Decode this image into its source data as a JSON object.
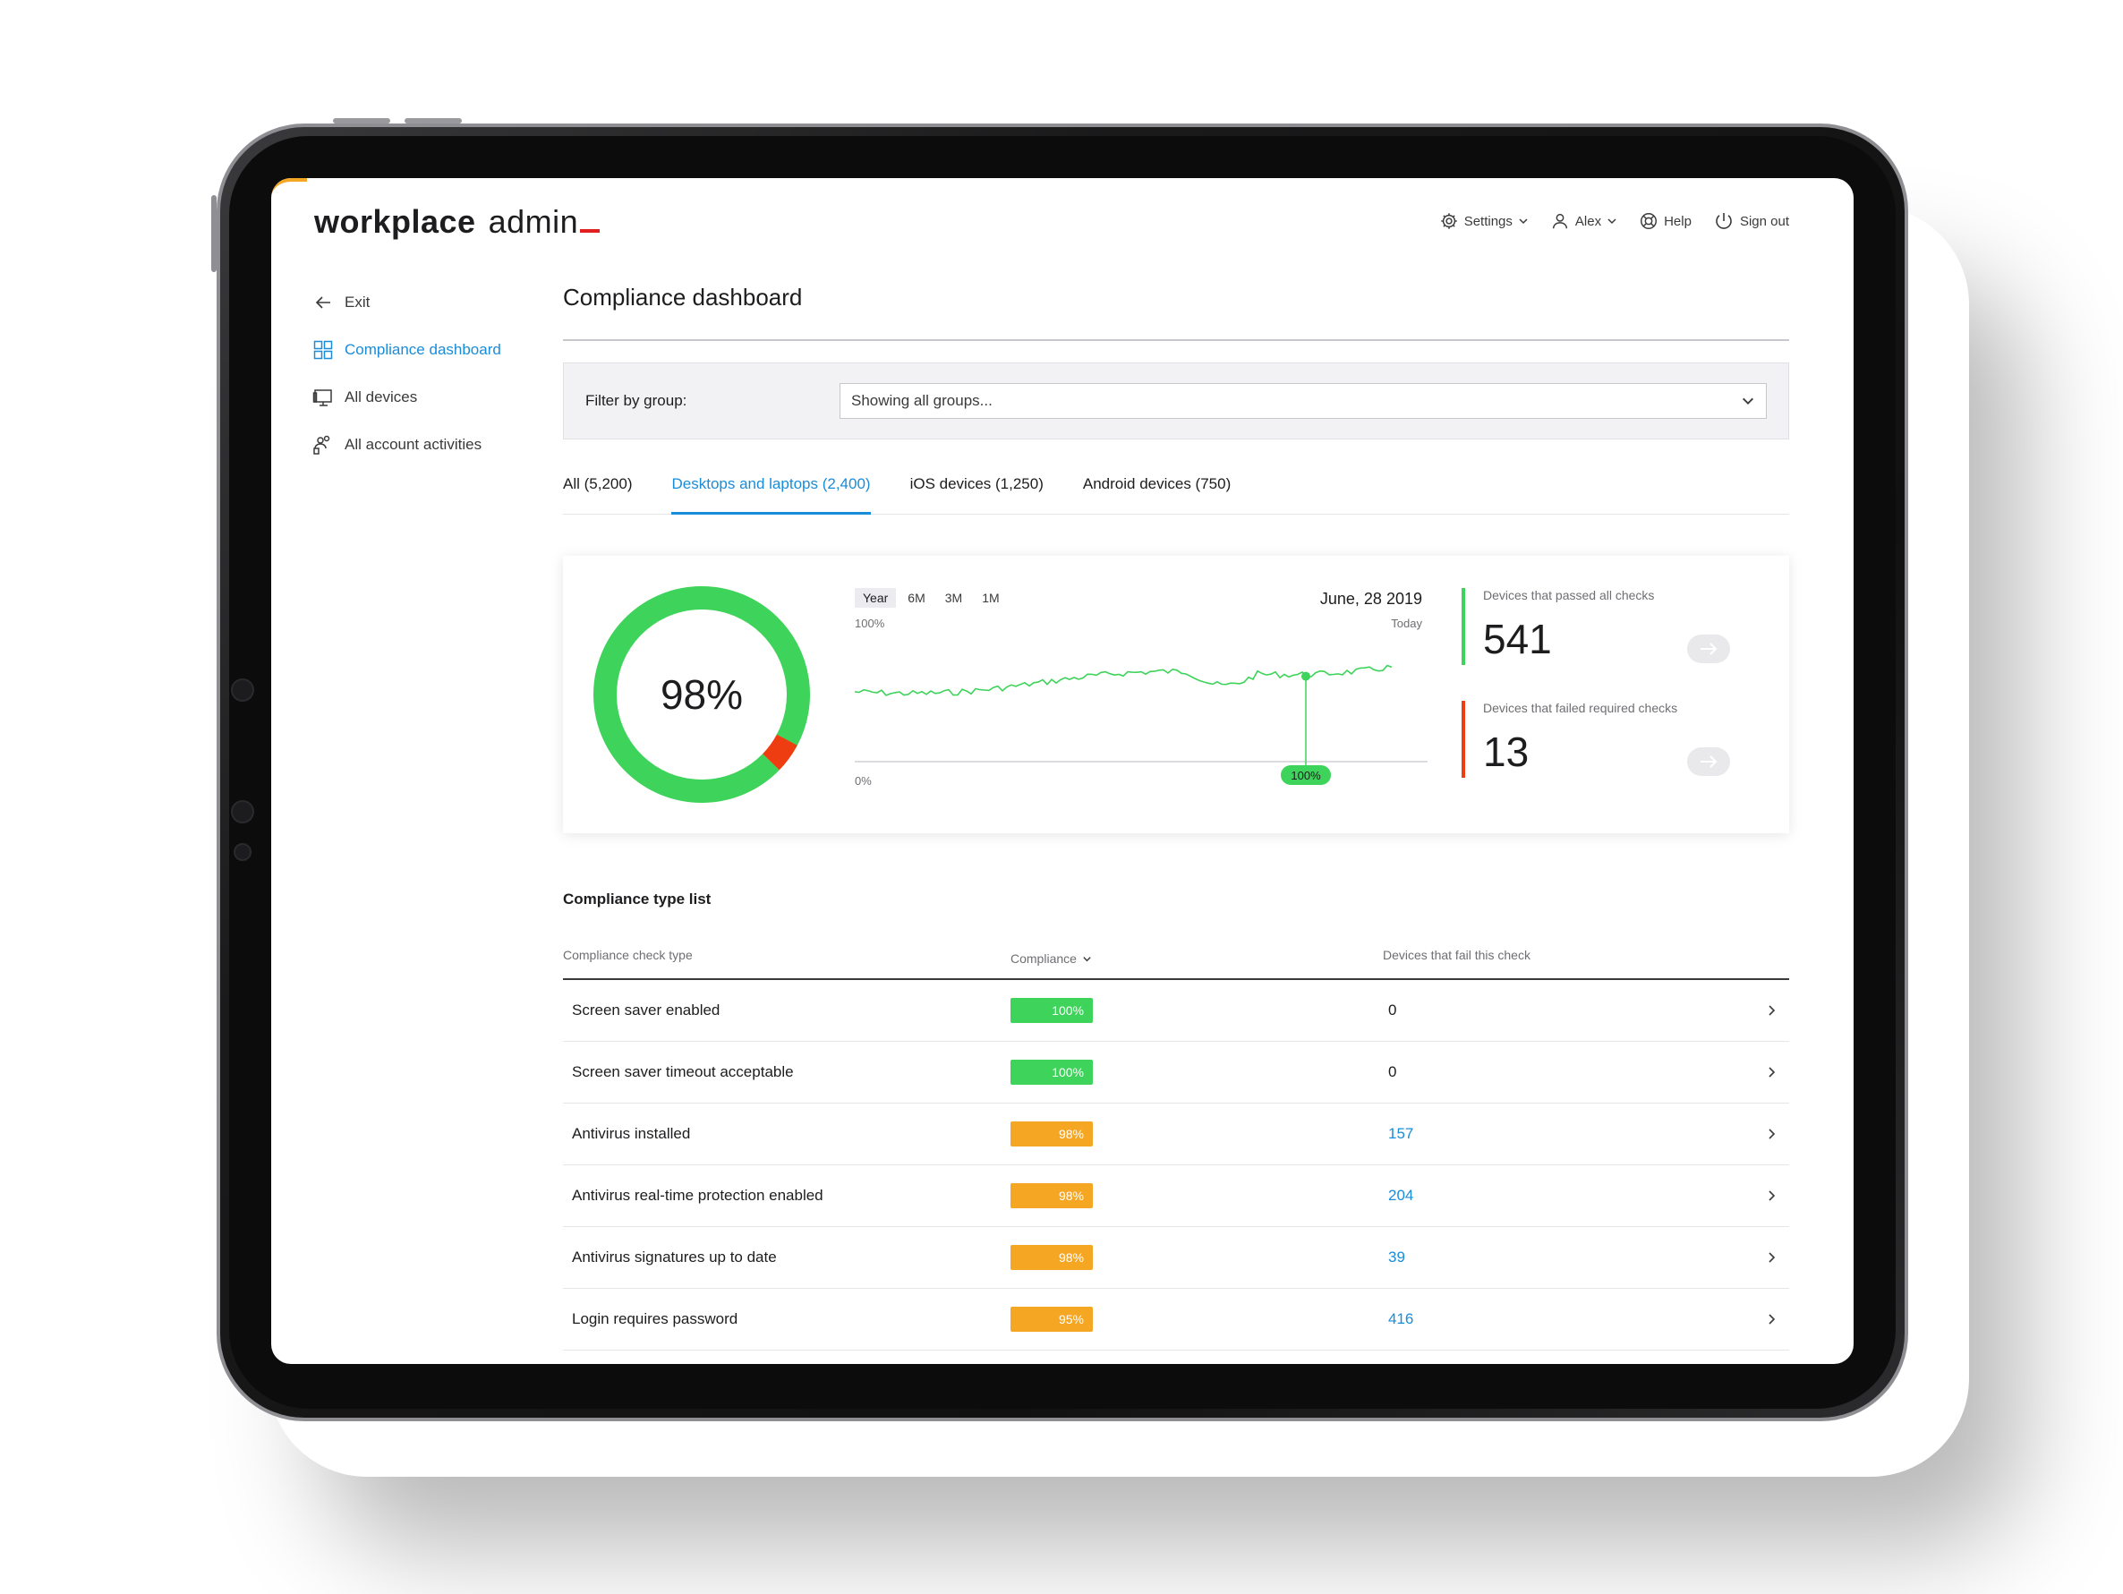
{
  "app": {
    "logo_bold": "workplace",
    "logo_light": "admin"
  },
  "topnav": {
    "settings": "Settings",
    "user": "Alex",
    "help": "Help",
    "signout": "Sign out"
  },
  "sidebar": {
    "items": [
      {
        "label": "Exit",
        "icon": "arrow-left-icon"
      },
      {
        "label": "Compliance dashboard",
        "icon": "dashboard-grid-icon",
        "active": true
      },
      {
        "label": "All devices",
        "icon": "monitor-icon"
      },
      {
        "label": "All account activities",
        "icon": "users-activity-icon"
      }
    ]
  },
  "page": {
    "title": "Compliance dashboard",
    "filter_label": "Filter by group:",
    "filter_value": "Showing all groups..."
  },
  "tabs": [
    {
      "label": "All (5,200)"
    },
    {
      "label": "Desktops and laptops (2,400)",
      "active": true
    },
    {
      "label": "iOS devices (1,250)"
    },
    {
      "label": "Android devices (750)"
    }
  ],
  "summary": {
    "donut_label": "98%",
    "donut_fraction": 0.98,
    "colors": {
      "pass": "#3ed35a",
      "fail": "#ef3d12",
      "accent": "#1a8cd8",
      "warn": "#f5a623"
    },
    "range_tabs": [
      "Year",
      "6M",
      "3M",
      "1M"
    ],
    "date": "June, 28 2019",
    "today": "Today",
    "y_top": "100%",
    "y_bottom": "0%",
    "marker_label": "100%",
    "passed_label": "Devices that passed all checks",
    "passed_value": "541",
    "failed_label": "Devices that failed required checks",
    "failed_value": "13"
  },
  "list": {
    "title": "Compliance type list",
    "col_type": "Compliance check type",
    "col_compliance": "Compliance",
    "col_fails": "Devices that fail this check",
    "rows": [
      {
        "name": "Screen saver enabled",
        "compliance": "100%",
        "status": "ok",
        "fails": "0"
      },
      {
        "name": "Screen saver timeout acceptable",
        "compliance": "100%",
        "status": "ok",
        "fails": "0"
      },
      {
        "name": "Antivirus installed",
        "compliance": "98%",
        "status": "warn",
        "fails": "157"
      },
      {
        "name": "Antivirus real-time protection enabled",
        "compliance": "98%",
        "status": "warn",
        "fails": "204"
      },
      {
        "name": "Antivirus signatures up to date",
        "compliance": "98%",
        "status": "warn",
        "fails": "39"
      },
      {
        "name": "Login requires password",
        "compliance": "95%",
        "status": "warn",
        "fails": "416"
      }
    ]
  }
}
